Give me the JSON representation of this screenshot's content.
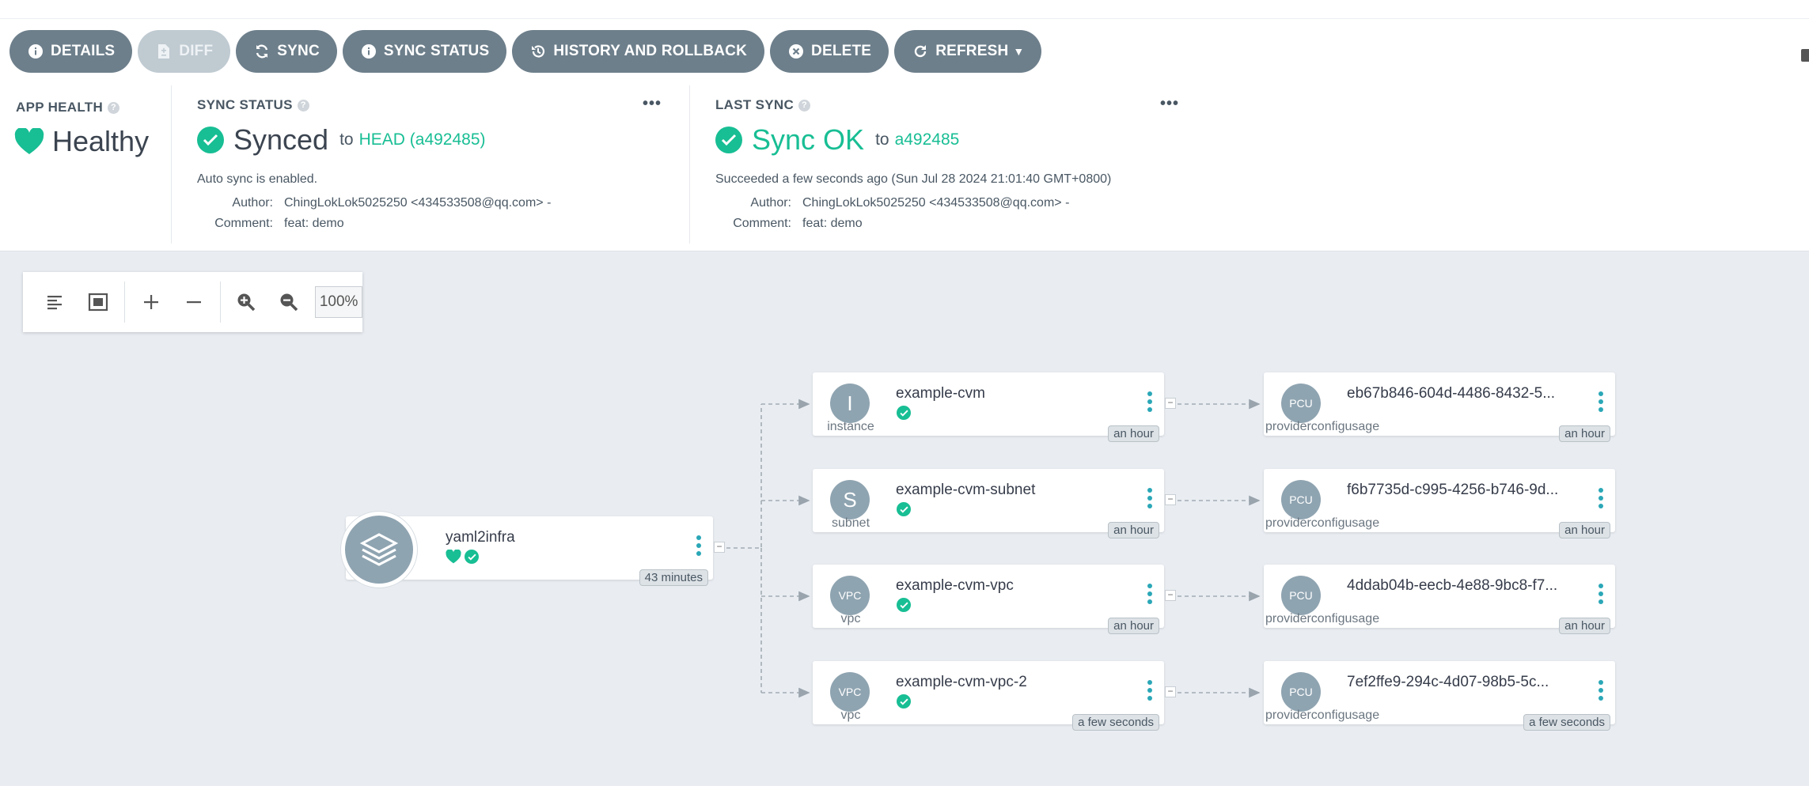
{
  "toolbar": {
    "details": "DETAILS",
    "diff": "DIFF",
    "sync": "SYNC",
    "sync_status": "SYNC STATUS",
    "history": "HISTORY AND ROLLBACK",
    "delete": "DELETE",
    "refresh": "REFRESH"
  },
  "app_health": {
    "title": "APP HEALTH",
    "value": "Healthy"
  },
  "sync_status": {
    "title": "SYNC STATUS",
    "value": "Synced",
    "to": "to",
    "revision": "HEAD (a492485)",
    "auto_sync": "Auto sync is enabled.",
    "author_label": "Author:",
    "author": "ChingLokLok5025250 <434533508@qq.com> -",
    "comment_label": "Comment:",
    "comment": "feat: demo"
  },
  "last_sync": {
    "title": "LAST SYNC",
    "value": "Sync OK",
    "to": "to",
    "revision": "a492485",
    "detail": "Succeeded a few seconds ago (Sun Jul 28 2024 21:01:40 GMT+0800)",
    "author_label": "Author:",
    "author": "ChingLokLok5025250 <434533508@qq.com> -",
    "comment_label": "Comment:",
    "comment": "feat: demo"
  },
  "graph_tools": {
    "zoom": "100%"
  },
  "colors": {
    "accent_green": "#18be94",
    "button_grey": "#6d7f8b",
    "node_icon": "#8fa4b1",
    "graph_bg": "#e9edf2"
  },
  "root": {
    "name": "yaml2infra",
    "age": "43 minutes"
  },
  "resources": [
    {
      "icon": "I",
      "kind": "instance",
      "name": "example-cvm",
      "age": "an hour",
      "child": {
        "icon": "PCU",
        "kind": "providerconfigusage",
        "name": "eb67b846-604d-4486-8432-5...",
        "age": "an hour"
      }
    },
    {
      "icon": "S",
      "kind": "subnet",
      "name": "example-cvm-subnet",
      "age": "an hour",
      "child": {
        "icon": "PCU",
        "kind": "providerconfigusage",
        "name": "f6b7735d-c995-4256-b746-9d...",
        "age": "an hour"
      }
    },
    {
      "icon": "VPC",
      "kind": "vpc",
      "name": "example-cvm-vpc",
      "age": "an hour",
      "child": {
        "icon": "PCU",
        "kind": "providerconfigusage",
        "name": "4ddab04b-eecb-4e88-9bc8-f7...",
        "age": "an hour"
      }
    },
    {
      "icon": "VPC",
      "kind": "vpc",
      "name": "example-cvm-vpc-2",
      "age": "a few seconds",
      "child": {
        "icon": "PCU",
        "kind": "providerconfigusage",
        "name": "7ef2ffe9-294c-4d07-98b5-5c...",
        "age": "a few seconds"
      }
    }
  ]
}
